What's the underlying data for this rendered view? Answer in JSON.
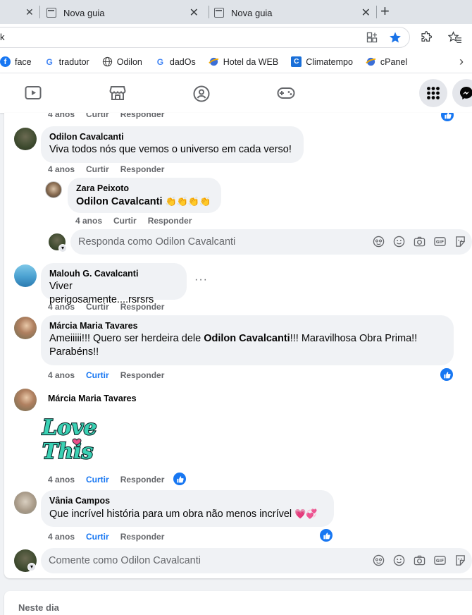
{
  "browser": {
    "tabs": [
      {
        "title": "Nova guia",
        "close": "✕"
      },
      {
        "title": "Nova guia",
        "close": "✕"
      }
    ],
    "first_tab_close": "✕",
    "new_tab": "+",
    "url_fragment": "k",
    "bookmarks": [
      {
        "label": "face",
        "icon": "facebook-icon"
      },
      {
        "label": "tradutor",
        "icon": "google-icon"
      },
      {
        "label": "Odilon",
        "icon": "globe-icon"
      },
      {
        "label": "dadOs",
        "icon": "google-icon"
      },
      {
        "label": "Hotel da WEB",
        "icon": "sphere-icon"
      },
      {
        "label": "Climatempo",
        "icon": "climatempo-icon"
      },
      {
        "label": "cPanel",
        "icon": "sphere-icon"
      }
    ],
    "bookmarks_more": "›"
  },
  "colors": {
    "accent": "#1877f2",
    "bubble": "#f0f2f5",
    "meta": "#65676b"
  },
  "comments": [
    {
      "time": "4 anos",
      "like": "Curtir",
      "reply": "Responder"
    },
    {
      "author": "Odilon Cavalcanti",
      "text": "Viva todos nós que vemos o universo em cada verso!",
      "time": "4 anos",
      "like": "Curtir",
      "reply": "Responder"
    },
    {
      "author": "Zara Peixoto",
      "mention": "Odilon Cavalcanti",
      "emoji": "👏👏👏👏",
      "time": "4 anos",
      "like": "Curtir",
      "reply": "Responder"
    },
    {
      "author": "Malouh G. Cavalcanti",
      "text": "Viver perigosamente....rsrsrs",
      "more": "···",
      "time": "4 anos",
      "like": "Curtir",
      "reply": "Responder"
    },
    {
      "author": "Márcia Maria Tavares",
      "text_before": "Ameiiiii!!! Quero ser herdeira dele ",
      "mention": "Odilon Cavalcanti",
      "text_after": "!!! Maravilhosa Obra Prima!!",
      "text_line2": "Parabéns!!",
      "time": "4 anos",
      "like": "Curtir",
      "reply": "Responder"
    },
    {
      "author": "Márcia Maria Tavares",
      "sticker_line1": "Love",
      "sticker_line2": "This",
      "time": "4 anos",
      "like": "Curtir",
      "reply": "Responder"
    },
    {
      "author": "Vânia Campos",
      "text": "Que incrível história para um obra não menos incrível ",
      "emoji": "💗💞",
      "time": "4 anos",
      "like": "Curtir",
      "reply": "Responder"
    }
  ],
  "reply_placeholder": "Responda como Odilon Cavalcanti",
  "comment_placeholder": "Comente como Odilon Cavalcanti",
  "next_section": "Neste dia",
  "gif_label": "GIF"
}
